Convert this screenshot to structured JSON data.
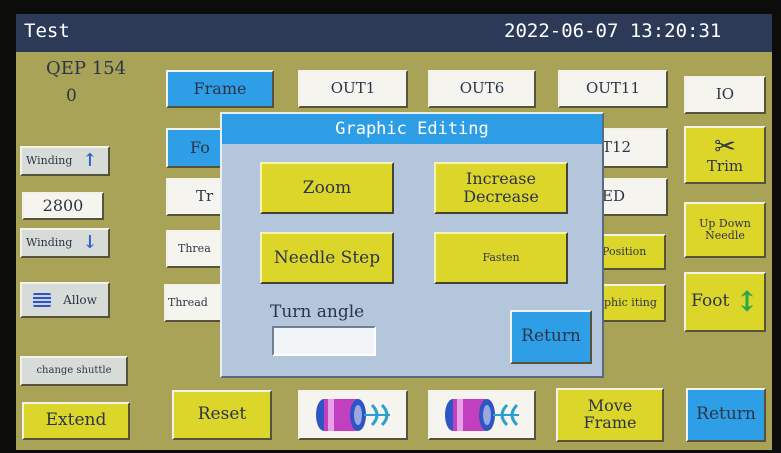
{
  "titlebar": {
    "title": "Test",
    "datetime": "2022-06-07 13:20:31"
  },
  "left": {
    "model": "QEP 154",
    "count": "0",
    "winding_up": "Winding",
    "winding_value": "2800",
    "winding_down": "Winding",
    "allow": "Allow",
    "change_shuttle": "change shuttle",
    "extend": "Extend"
  },
  "grid": {
    "frame": "Frame",
    "out1": "OUT1",
    "out6": "OUT6",
    "out11": "OUT11",
    "io": "IO",
    "fo": "Fo",
    "out12": "T12",
    "tr": "Tr",
    "ed": "ED",
    "threa": "Threa",
    "position": "Position",
    "thread": "Thread",
    "graphic_editing": "phic iting"
  },
  "right": {
    "trim": "Trim",
    "up_down_needle": "Up Down Needle",
    "foot": "Foot",
    "return": "Return"
  },
  "bottom": {
    "reset": "Reset",
    "move_frame": "Move Frame"
  },
  "dialog": {
    "title": "Graphic Editing",
    "zoom": "Zoom",
    "increase_decrease": "Increase Decrease",
    "needle_step": "Needle Step",
    "fasten": "Fasten",
    "turn_angle_label": "Turn angle",
    "turn_angle_value": "",
    "return": "Return"
  },
  "colors": {
    "background": "#a8a357",
    "titlebar": "#2c3a58",
    "accent_blue": "#2e9fe6",
    "button_yellow": "#dcd52a",
    "button_white": "#f5f4ee",
    "dialog_bg": "#b3c6dc"
  }
}
